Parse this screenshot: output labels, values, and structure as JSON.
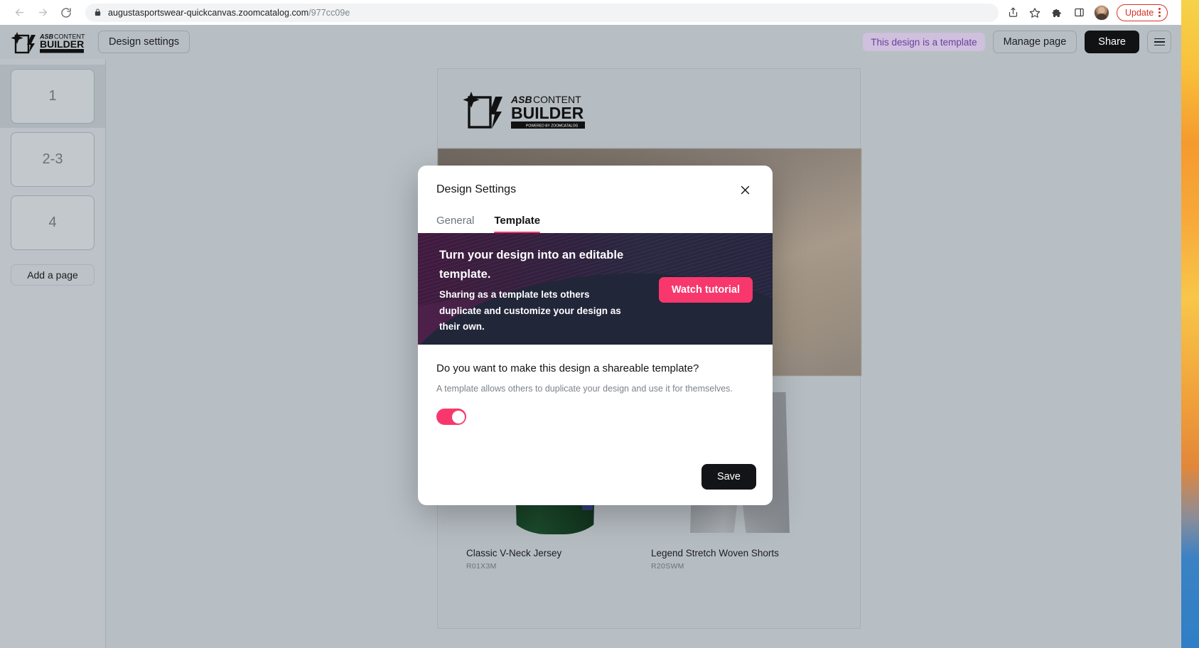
{
  "browser": {
    "back_label": "Back",
    "forward_label": "Forward",
    "reload_label": "Reload",
    "url_secure": "augustasportswear-quickcanvas.zoomcatalog.com",
    "url_path": "/977cc09e",
    "share_label": "Share this page",
    "bookmark_label": "Bookmark this tab",
    "extensions_label": "Extensions",
    "side_panel_label": "Side panel",
    "profile_label": "Profile",
    "update_label": "Update",
    "menu_label": "Customize and control Google Chrome"
  },
  "app_header": {
    "logo_line1": "ASB CONTENT",
    "logo_line2": "BUILDER",
    "design_settings_label": "Design settings",
    "template_badge": "This design is a template",
    "manage_page_label": "Manage page",
    "share_label": "Share",
    "menu_label": "Menu"
  },
  "pages_panel": {
    "pages": [
      {
        "label": "1",
        "selected": true
      },
      {
        "label": "2-3",
        "selected": false
      },
      {
        "label": "4",
        "selected": false
      }
    ],
    "add_page_label": "Add a page"
  },
  "canvas": {
    "logo_line1": "ASB CONTENT",
    "logo_line2": "BUILDER",
    "logo_tagline": "POWERED BY ZOOMCATALOG",
    "products": [
      {
        "name": "Classic V-Neck Jersey",
        "sku": "R01X3M"
      },
      {
        "name": "Legend Stretch Woven Shorts",
        "sku": "R20SWM"
      }
    ]
  },
  "modal": {
    "title": "Design Settings",
    "close_label": "Close",
    "tabs": [
      {
        "label": "General",
        "active": false
      },
      {
        "label": "Template",
        "active": true
      }
    ],
    "promo": {
      "title": "Turn your design into an editable template.",
      "subtitle": "Sharing as a template lets others duplicate and customize your design as their own.",
      "cta_label": "Watch tutorial"
    },
    "question": "Do you want to make this design a shareable template?",
    "question_help": "A template allows others to duplicate your design and use it for themselves.",
    "toggle_state": "on",
    "save_label": "Save"
  },
  "colors": {
    "accent_pink": "#f8386d",
    "badge_text": "#6b3fa0",
    "badge_bg": "#cfc0dd",
    "dark_button": "#131417",
    "update_red": "#d93025"
  }
}
